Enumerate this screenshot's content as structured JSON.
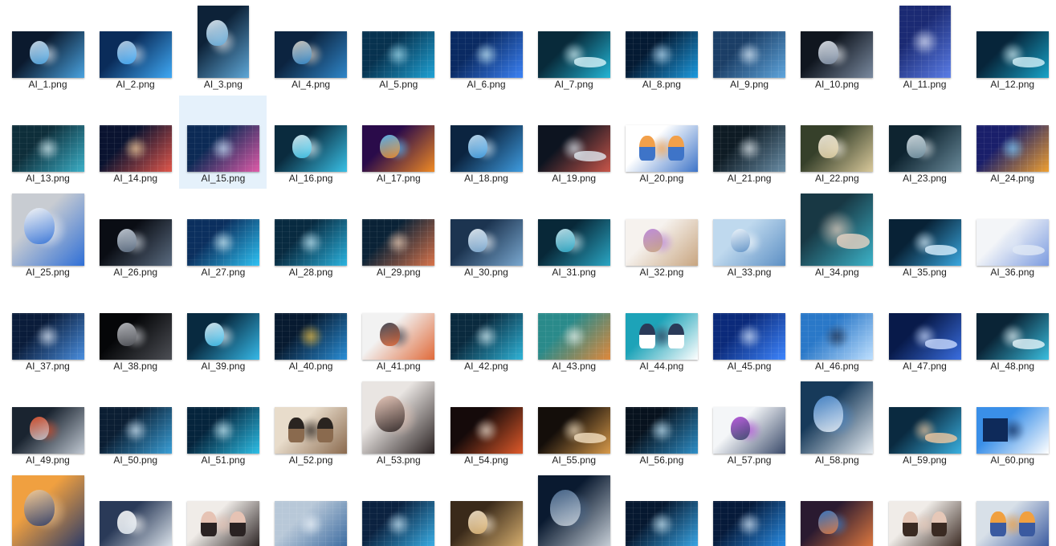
{
  "explorer": {
    "selected_file": "AI_15.png",
    "files": [
      {
        "name": "AI_1.png",
        "aspect": "wide",
        "palette": [
          "#0b1a2e",
          "#4aa3e0",
          "#d9e6f2"
        ],
        "motif": "robot-laptop"
      },
      {
        "name": "AI_2.png",
        "aspect": "wide",
        "palette": [
          "#0a2c5a",
          "#3fa9f5",
          "#c7d7e8"
        ],
        "motif": "head"
      },
      {
        "name": "AI_3.png",
        "aspect": "tall",
        "palette": [
          "#0d2238",
          "#5fa8d8",
          "#e8eef4"
        ],
        "motif": "head"
      },
      {
        "name": "AI_4.png",
        "aspect": "wide",
        "palette": [
          "#0c2440",
          "#2f86c9",
          "#e2d6c8"
        ],
        "motif": "head"
      },
      {
        "name": "AI_5.png",
        "aspect": "wide",
        "palette": [
          "#07324f",
          "#1fa3d6",
          "#a6e3f5"
        ],
        "motif": "brain"
      },
      {
        "name": "AI_6.png",
        "aspect": "wide",
        "palette": [
          "#0a2a62",
          "#3b82f6",
          "#c9f0ff"
        ],
        "motif": "text-ai"
      },
      {
        "name": "AI_7.png",
        "aspect": "wide",
        "palette": [
          "#082a3a",
          "#23b6d6",
          "#d6f4fa"
        ],
        "motif": "hand"
      },
      {
        "name": "AI_8.png",
        "aspect": "wide",
        "palette": [
          "#041a33",
          "#1d9be0",
          "#bfe6ff"
        ],
        "motif": "circuit"
      },
      {
        "name": "AI_9.png",
        "aspect": "wide",
        "palette": [
          "#1b3e66",
          "#5fa6de",
          "#dff0ff"
        ],
        "motif": "text-ai"
      },
      {
        "name": "AI_10.png",
        "aspect": "wide",
        "palette": [
          "#10161f",
          "#7a8aa0",
          "#e8ecf1"
        ],
        "motif": "robot"
      },
      {
        "name": "AI_11.png",
        "aspect": "tall",
        "palette": [
          "#1b2a73",
          "#5a7de8",
          "#e7ecff"
        ],
        "motif": "text-ai"
      },
      {
        "name": "AI_12.png",
        "aspect": "wide",
        "palette": [
          "#07253a",
          "#18a4c9",
          "#d4f3fa"
        ],
        "motif": "hand"
      },
      {
        "name": "AI_13.png",
        "aspect": "wide",
        "palette": [
          "#0e2e3a",
          "#3bb0c8",
          "#dff6fb"
        ],
        "motif": "text-ai"
      },
      {
        "name": "AI_14.png",
        "aspect": "wide",
        "palette": [
          "#0a1330",
          "#e2564a",
          "#ffd6a0"
        ],
        "motif": "text-ai"
      },
      {
        "name": "AI_15.png",
        "aspect": "wide",
        "palette": [
          "#0c2a55",
          "#e05aa8",
          "#cfe6ff"
        ],
        "motif": "text-ai"
      },
      {
        "name": "AI_16.png",
        "aspect": "wide",
        "palette": [
          "#0a2b3e",
          "#39c0e6",
          "#e6f7fb"
        ],
        "motif": "robot"
      },
      {
        "name": "AI_17.png",
        "aspect": "wide",
        "palette": [
          "#2a0b4a",
          "#f08a24",
          "#5bc1ff"
        ],
        "motif": "head"
      },
      {
        "name": "AI_18.png",
        "aspect": "wide",
        "palette": [
          "#0b2440",
          "#3f9ce0",
          "#cfe8fa"
        ],
        "motif": "head"
      },
      {
        "name": "AI_19.png",
        "aspect": "wide",
        "palette": [
          "#0d1420",
          "#c9564a",
          "#e0e8f0"
        ],
        "motif": "hand"
      },
      {
        "name": "AI_20.png",
        "aspect": "wide",
        "palette": [
          "#ffffff",
          "#3e74c8",
          "#f2a04a"
        ],
        "motif": "people"
      },
      {
        "name": "AI_21.png",
        "aspect": "wide",
        "palette": [
          "#0e1b24",
          "#6b8fa8",
          "#e6eef3"
        ],
        "motif": "text-ai"
      },
      {
        "name": "AI_22.png",
        "aspect": "wide",
        "palette": [
          "#36402a",
          "#d9c99b",
          "#f5efe3"
        ],
        "motif": "person"
      },
      {
        "name": "AI_23.png",
        "aspect": "wide",
        "palette": [
          "#0e2430",
          "#6a8a9a",
          "#dfe8ec"
        ],
        "motif": "robot"
      },
      {
        "name": "AI_24.png",
        "aspect": "wide",
        "palette": [
          "#1a1f6a",
          "#f0a030",
          "#7fd0ff"
        ],
        "motif": "circuit"
      },
      {
        "name": "AI_25.png",
        "aspect": "square",
        "palette": [
          "#c8ccd2",
          "#2f6fd6",
          "#fafafa"
        ],
        "motif": "robot-laptop"
      },
      {
        "name": "AI_26.png",
        "aspect": "wide",
        "palette": [
          "#0a0d14",
          "#5a6b80",
          "#d0d8e2"
        ],
        "motif": "head"
      },
      {
        "name": "AI_27.png",
        "aspect": "wide",
        "palette": [
          "#0b2f5e",
          "#2ec3f5",
          "#d6f5ff"
        ],
        "motif": "text-ai"
      },
      {
        "name": "AI_28.png",
        "aspect": "wide",
        "palette": [
          "#082a40",
          "#2bb4e0",
          "#c9f1ff"
        ],
        "motif": "text-ai"
      },
      {
        "name": "AI_29.png",
        "aspect": "wide",
        "palette": [
          "#0a2236",
          "#d9734a",
          "#f4d2b8"
        ],
        "motif": "brain"
      },
      {
        "name": "AI_30.png",
        "aspect": "wide",
        "palette": [
          "#1c3450",
          "#7aa8d0",
          "#eef5fb"
        ],
        "motif": "robot"
      },
      {
        "name": "AI_31.png",
        "aspect": "wide",
        "palette": [
          "#082838",
          "#2aa6c4",
          "#cdeff7"
        ],
        "motif": "head"
      },
      {
        "name": "AI_32.png",
        "aspect": "wide",
        "palette": [
          "#f6f2ee",
          "#c8a580",
          "#b67fd8"
        ],
        "motif": "robot"
      },
      {
        "name": "AI_33.png",
        "aspect": "wide",
        "palette": [
          "#bfd9ee",
          "#5c8fc4",
          "#f3f8fc"
        ],
        "motif": "robot"
      },
      {
        "name": "AI_34.png",
        "aspect": "square",
        "palette": [
          "#183844",
          "#3cb3c9",
          "#e8d3c3"
        ],
        "motif": "hand"
      },
      {
        "name": "AI_35.png",
        "aspect": "wide",
        "palette": [
          "#082236",
          "#3aa8e0",
          "#d8f0ff"
        ],
        "motif": "hand"
      },
      {
        "name": "AI_36.png",
        "aspect": "wide",
        "palette": [
          "#f3f5f8",
          "#7b9be0",
          "#e0e8f5"
        ],
        "motif": "hand"
      },
      {
        "name": "AI_37.png",
        "aspect": "wide",
        "palette": [
          "#0a1c3a",
          "#4a8fe0",
          "#e6f0ff"
        ],
        "motif": "text-ai"
      },
      {
        "name": "AI_38.png",
        "aspect": "wide",
        "palette": [
          "#050608",
          "#4d4f55",
          "#c7c9ce"
        ],
        "motif": "head"
      },
      {
        "name": "AI_39.png",
        "aspect": "wide",
        "palette": [
          "#082a40",
          "#36b9e8",
          "#eaf6fb"
        ],
        "motif": "robot"
      },
      {
        "name": "AI_40.png",
        "aspect": "wide",
        "palette": [
          "#071a30",
          "#2a8fd8",
          "#f0c040"
        ],
        "motif": "circuit"
      },
      {
        "name": "AI_41.png",
        "aspect": "wide",
        "palette": [
          "#f2f2f2",
          "#e06a3a",
          "#303848"
        ],
        "motif": "head"
      },
      {
        "name": "AI_42.png",
        "aspect": "wide",
        "palette": [
          "#0a2a3e",
          "#2fb4d8",
          "#d8f3fa"
        ],
        "motif": "text-ai"
      },
      {
        "name": "AI_43.png",
        "aspect": "wide",
        "palette": [
          "#2a8a8a",
          "#e0883a",
          "#e8f4f0"
        ],
        "motif": "brain"
      },
      {
        "name": "AI_44.png",
        "aspect": "wide",
        "palette": [
          "#1da3b8",
          "#ffffff",
          "#2a3a58"
        ],
        "motif": "people"
      },
      {
        "name": "AI_45.png",
        "aspect": "wide",
        "palette": [
          "#0b2a7a",
          "#3e86ff",
          "#d6e6ff"
        ],
        "motif": "text-ai"
      },
      {
        "name": "AI_46.png",
        "aspect": "wide",
        "palette": [
          "#2a78c8",
          "#bfe0ff",
          "#1a2a48"
        ],
        "motif": "text-ai"
      },
      {
        "name": "AI_47.png",
        "aspect": "wide",
        "palette": [
          "#081a4a",
          "#3a6ee0",
          "#c9dbff"
        ],
        "motif": "hand"
      },
      {
        "name": "AI_48.png",
        "aspect": "wide",
        "palette": [
          "#0a2436",
          "#3abfe0",
          "#e6f6fb"
        ],
        "motif": "hand"
      },
      {
        "name": "AI_49.png",
        "aspect": "wide",
        "palette": [
          "#1a2430",
          "#c0c8d2",
          "#e0502a"
        ],
        "motif": "robot"
      },
      {
        "name": "AI_50.png",
        "aspect": "wide",
        "palette": [
          "#0b1e33",
          "#3aa0d8",
          "#d9efff"
        ],
        "motif": "text-ai"
      },
      {
        "name": "AI_51.png",
        "aspect": "wide",
        "palette": [
          "#05243c",
          "#2dc0e8",
          "#cff4ff"
        ],
        "motif": "circuit"
      },
      {
        "name": "AI_52.png",
        "aspect": "wide",
        "palette": [
          "#e8dccb",
          "#8a6a4e",
          "#2a2420"
        ],
        "motif": "people"
      },
      {
        "name": "AI_53.png",
        "aspect": "square",
        "palette": [
          "#e9e5e2",
          "#2a2222",
          "#e6c3b4"
        ],
        "motif": "person"
      },
      {
        "name": "AI_54.png",
        "aspect": "wide",
        "palette": [
          "#150a0a",
          "#e05a2a",
          "#f2e2d2"
        ],
        "motif": "text-dark"
      },
      {
        "name": "AI_55.png",
        "aspect": "wide",
        "palette": [
          "#140e0a",
          "#d89a4a",
          "#f4e0c0"
        ],
        "motif": "hand"
      },
      {
        "name": "AI_56.png",
        "aspect": "wide",
        "palette": [
          "#07121e",
          "#2e8fc8",
          "#c8ecff"
        ],
        "motif": "brain"
      },
      {
        "name": "AI_57.png",
        "aspect": "wide",
        "palette": [
          "#f4f6f8",
          "#3a4a6a",
          "#b04ad8"
        ],
        "motif": "head"
      },
      {
        "name": "AI_58.png",
        "aspect": "square",
        "palette": [
          "#173a5a",
          "#e6ecf2",
          "#4a8ad0"
        ],
        "motif": "robot"
      },
      {
        "name": "AI_59.png",
        "aspect": "wide",
        "palette": [
          "#0a2a40",
          "#3ab0e0",
          "#f0c8a0"
        ],
        "motif": "hand"
      },
      {
        "name": "AI_60.png",
        "aspect": "wide",
        "palette": [
          "#3a8fe8",
          "#ffffff",
          "#0e2a5a"
        ],
        "motif": "text-doc"
      },
      {
        "name": "",
        "aspect": "square",
        "palette": [
          "#f0a040",
          "#2a3a68",
          "#f5d0a0"
        ],
        "motif": "person"
      },
      {
        "name": "",
        "aspect": "wide",
        "palette": [
          "#2a3a58",
          "#dce4ec",
          "#f8f8f8"
        ],
        "motif": "robot"
      },
      {
        "name": "",
        "aspect": "wide",
        "palette": [
          "#f0ece8",
          "#2a2222",
          "#e6c3b4"
        ],
        "motif": "people"
      },
      {
        "name": "",
        "aspect": "wide",
        "palette": [
          "#b8c8d8",
          "#3a6aa0",
          "#eef4fa"
        ],
        "motif": "text-ai"
      },
      {
        "name": "",
        "aspect": "wide",
        "palette": [
          "#0b2240",
          "#3ab0e8",
          "#cfeeff"
        ],
        "motif": "circuit"
      },
      {
        "name": "",
        "aspect": "wide",
        "palette": [
          "#3a2a1a",
          "#d8b070",
          "#f4e6d0"
        ],
        "motif": "person"
      },
      {
        "name": "",
        "aspect": "square",
        "palette": [
          "#0a1a30",
          "#c8d0d8",
          "#4a6a90"
        ],
        "motif": "robot"
      },
      {
        "name": "",
        "aspect": "wide",
        "palette": [
          "#061830",
          "#3aa8e8",
          "#d0f0ff"
        ],
        "motif": "circuit"
      },
      {
        "name": "",
        "aspect": "wide",
        "palette": [
          "#061a3a",
          "#2a8fe8",
          "#d8ecff"
        ],
        "motif": "text-ai"
      },
      {
        "name": "",
        "aspect": "wide",
        "palette": [
          "#2a1a30",
          "#e07a40",
          "#3a80d0"
        ],
        "motif": "person"
      },
      {
        "name": "",
        "aspect": "wide",
        "palette": [
          "#f0ece8",
          "#3a2a22",
          "#e6c8b8"
        ],
        "motif": "people"
      },
      {
        "name": "",
        "aspect": "wide",
        "palette": [
          "#d8e0e8",
          "#3a5aa0",
          "#f0a040"
        ],
        "motif": "people"
      }
    ]
  }
}
